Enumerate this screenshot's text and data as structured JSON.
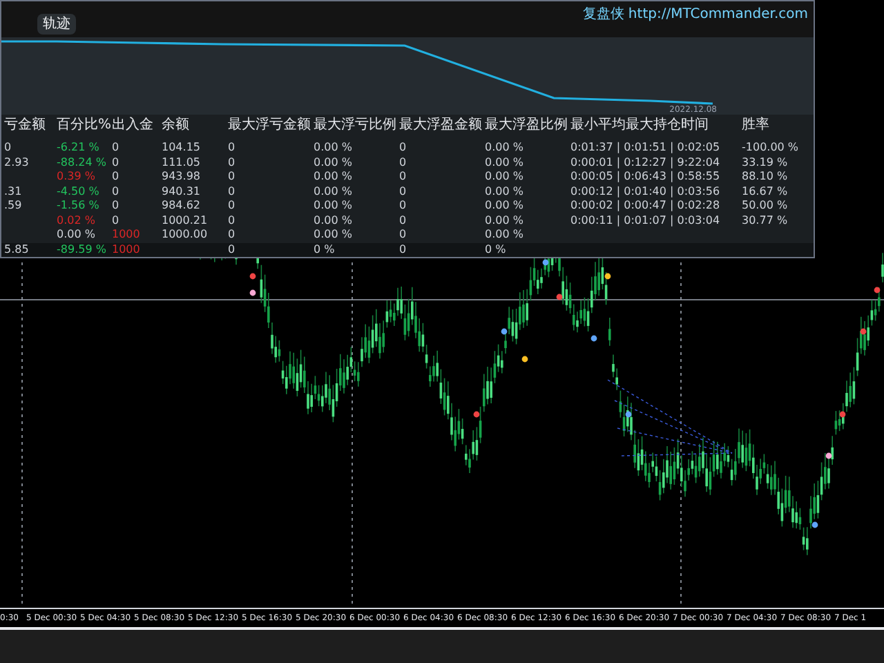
{
  "panel": {
    "brand": "复盘侠 http://MTCommander.com",
    "tabs": [
      {
        "label": "轨迹",
        "selected": true
      }
    ],
    "date": "2022.12.08",
    "columns": [
      "亏金额",
      "百分比%",
      "出入金",
      "余额",
      "最大浮亏金额",
      "最大浮亏比例",
      "最大浮盈金额",
      "最大浮盈比例",
      "最小平均最大持仓时间",
      "胜率"
    ],
    "rows": [
      {
        "cells": [
          "0",
          "-6.21 %",
          "0",
          "104.15",
          "0",
          "0.00 %",
          "0",
          "0.00 %",
          "0:01:37 | 0:01:51 | 0:02:05",
          "-100.00 %"
        ],
        "color": "#22c55e",
        "deposit": false
      },
      {
        "cells": [
          "2.93",
          "-88.24 %",
          "0",
          "111.05",
          "0",
          "0.00 %",
          "0",
          "0.00 %",
          "0:00:01 | 0:12:27 | 9:22:04",
          "33.19 %"
        ],
        "color": "#22c55e",
        "deposit": false
      },
      {
        "cells": [
          "",
          "0.39 %",
          "0",
          "943.98",
          "0",
          "0.00 %",
          "0",
          "0.00 %",
          "0:00:05 | 0:06:43 | 0:58:55",
          "88.10 %"
        ],
        "color": "#dc2626",
        "deposit": false
      },
      {
        "cells": [
          ".31",
          "-4.50 %",
          "0",
          "940.31",
          "0",
          "0.00 %",
          "0",
          "0.00 %",
          "0:00:12 | 0:01:40 | 0:03:56",
          "16.67 %"
        ],
        "color": "#22c55e",
        "deposit": false
      },
      {
        "cells": [
          ".59",
          "-1.56 %",
          "0",
          "984.62",
          "0",
          "0.00 %",
          "0",
          "0.00 %",
          "0:00:02 | 0:00:47 | 0:02:28",
          "50.00 %"
        ],
        "color": "#22c55e",
        "deposit": false
      },
      {
        "cells": [
          "",
          "0.02 %",
          "0",
          "1000.21",
          "0",
          "0.00 %",
          "0",
          "0.00 %",
          "0:00:11 | 0:01:07 | 0:03:04",
          "30.77 %"
        ],
        "color": "#dc2626",
        "deposit": false
      },
      {
        "cells": [
          "",
          "0.00 %",
          "1000",
          "1000.00",
          "0",
          "0.00 %",
          "0",
          "0.00 %",
          "",
          ""
        ],
        "color": "#d1d5db",
        "deposit": true
      }
    ],
    "total": {
      "cells": [
        "5.85",
        "-89.59 %",
        "1000",
        "",
        "0",
        "0 %",
        "0",
        "0 %",
        "",
        ""
      ],
      "color": "#22c55e",
      "deposit": true
    }
  },
  "x_axis": [
    "0:30",
    "5 Dec 00:30",
    "5 Dec 04:30",
    "5 Dec 08:30",
    "5 Dec 12:30",
    "5 Dec 16:30",
    "5 Dec 20:30",
    "6 Dec 00:30",
    "6 Dec 04:30",
    "6 Dec 08:30",
    "6 Dec 12:30",
    "6 Dec 16:30",
    "6 Dec 20:30",
    "7 Dec 00:30",
    "7 Dec 04:30",
    "7 Dec 08:30",
    "7 Dec 1"
  ]
}
